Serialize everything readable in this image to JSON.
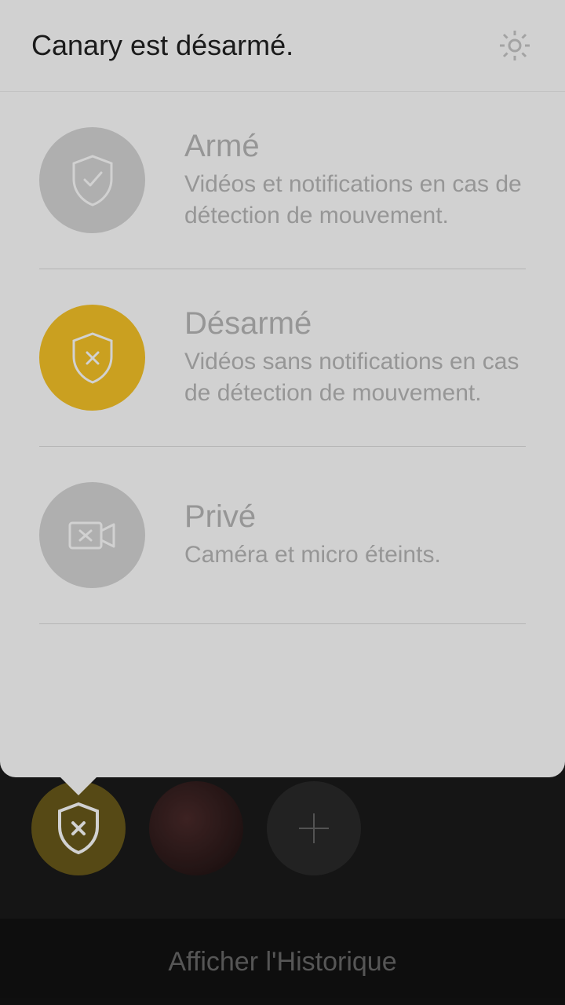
{
  "header": {
    "title": "Canary est désarmé."
  },
  "modes": [
    {
      "id": "armed",
      "title": "Armé",
      "description": "Vidéos et notifications en cas de détection de mouvement.",
      "active": false
    },
    {
      "id": "disarmed",
      "title": "Désarmé",
      "description": "Vidéos sans notifications en cas de détection de mouvement.",
      "active": true
    },
    {
      "id": "private",
      "title": "Privé",
      "description": "Caméra et micro éteints.",
      "active": false
    }
  ],
  "footer": {
    "history_label": "Afficher l'Historique"
  },
  "colors": {
    "accent": "#f7c428",
    "inactive_circle": "#d6d6d6",
    "text_muted": "#b8b8b8"
  }
}
